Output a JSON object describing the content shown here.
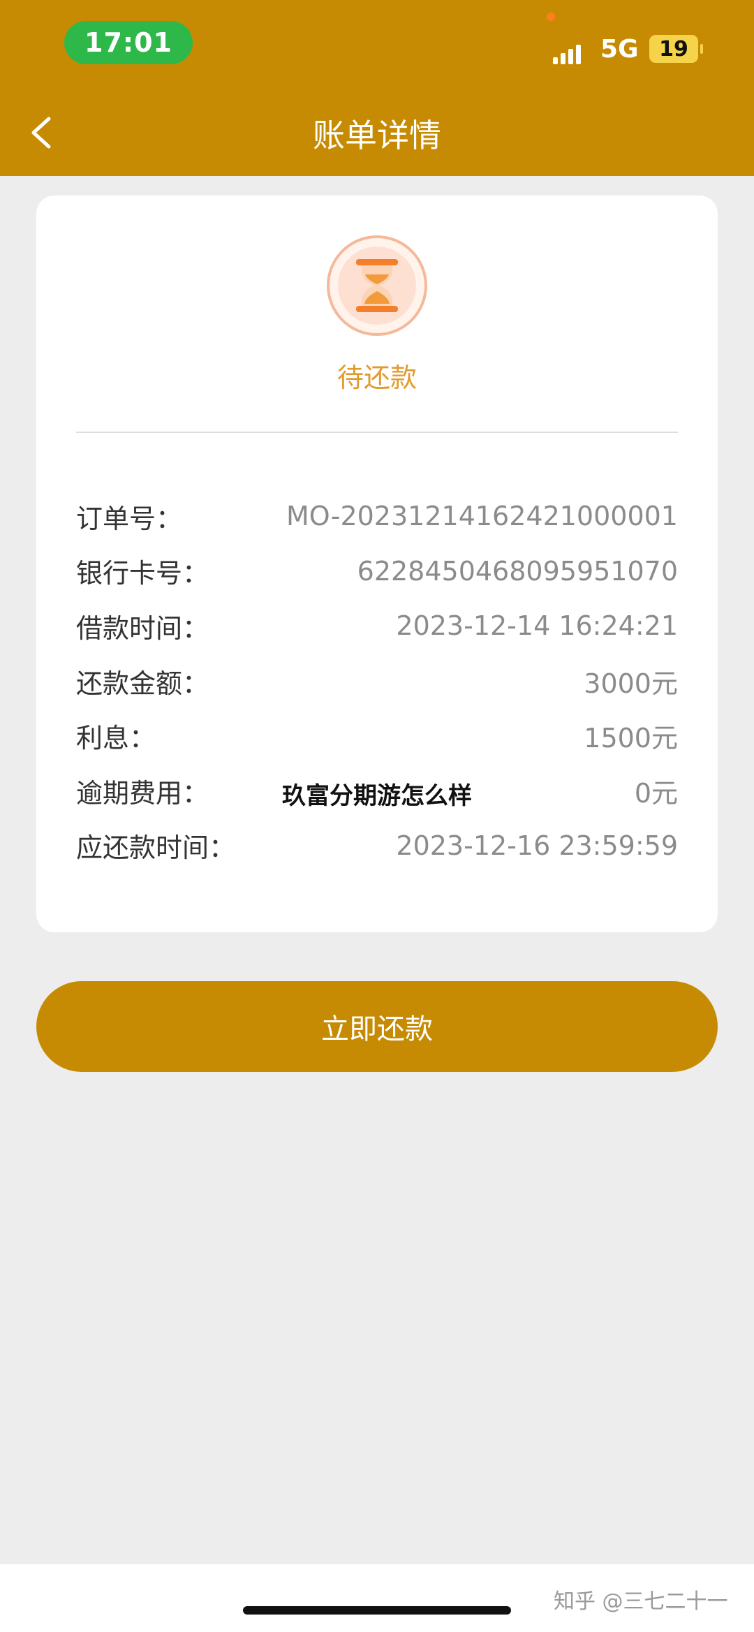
{
  "status_bar": {
    "time": "17:01",
    "network": "5G",
    "battery": "19"
  },
  "nav": {
    "title": "账单详情",
    "back_icon": "chevron-left-icon"
  },
  "status": {
    "icon": "hourglass-icon",
    "text": "待还款",
    "accent_color": "#e39a2c"
  },
  "details": [
    {
      "label": "订单号：",
      "value": "MO-20231214162421000001"
    },
    {
      "label": "银行卡号：",
      "value": "6228450468095951070"
    },
    {
      "label": "借款时间：",
      "value": "2023-12-14 16:24:21"
    },
    {
      "label": "还款金额：",
      "value": "3000元"
    },
    {
      "label": "利息：",
      "value": "1500元"
    },
    {
      "label": "逾期费用：",
      "value": "0元"
    },
    {
      "label": "应还款时间：",
      "value": "2023-12-16 23:59:59"
    }
  ],
  "overlay_title": "玖富分期游怎么样",
  "action": {
    "pay_label": "立即还款"
  },
  "footer": {
    "credit": "知乎 @三七二十一"
  },
  "colors": {
    "brand": "#c68b03",
    "background": "#ededed",
    "status_pill": "#2fb84a"
  }
}
